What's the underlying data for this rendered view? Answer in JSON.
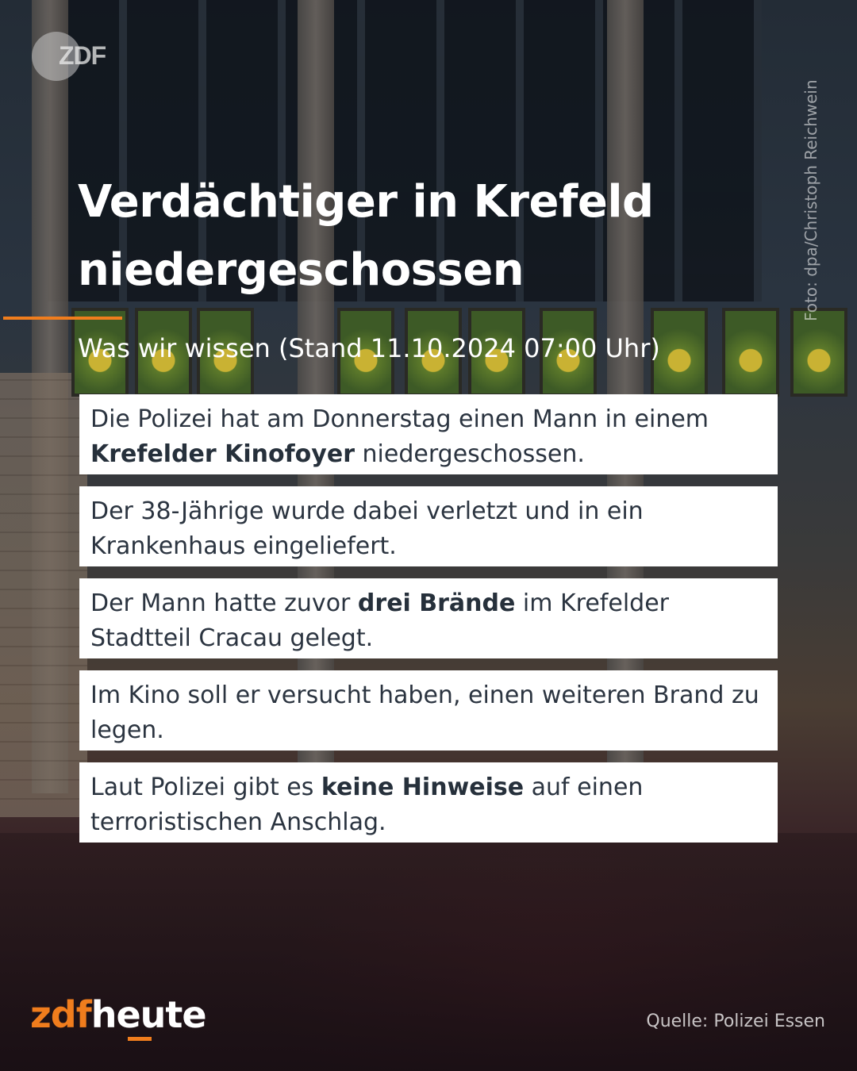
{
  "header": {
    "broadcaster_logo": "ZDF",
    "photo_credit": "Foto: dpa/Christoph Reichwein"
  },
  "title": "Verdächtiger in Krefeld niedergeschossen",
  "subtitle": "Was wir wissen (Stand 11.10.2024 07:00 Uhr)",
  "facts": [
    {
      "before": "Die Polizei hat am Donnerstag einen Mann in einem ",
      "bold": "Krefelder Kinofoyer",
      "after": " niedergeschossen."
    },
    {
      "before": "Der 38-Jährige wurde dabei verletzt und in ein Krankenhaus eingeliefert.",
      "bold": "",
      "after": ""
    },
    {
      "before": "Der Mann hatte zuvor ",
      "bold": "drei Brände",
      "after": " im Krefelder Stadtteil Cracau gelegt."
    },
    {
      "before": "Im Kino soll er versucht haben, einen weiteren Brand zu legen.",
      "bold": "",
      "after": ""
    },
    {
      "before": "Laut Polizei gibt es ",
      "bold": "keine Hinweise",
      "after": " auf einen terroristischen Anschlag."
    }
  ],
  "footer": {
    "brand_zdf": "zdf",
    "brand_heute": "heute",
    "source": "Quelle: Polizei Essen"
  },
  "colors": {
    "accent": "#f07d1d",
    "card_background": "#ffffff",
    "text_dark": "#2b3440"
  }
}
